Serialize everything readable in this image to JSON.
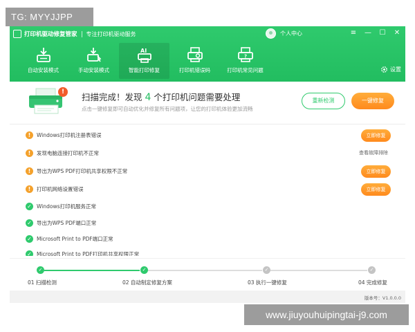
{
  "watermarks": {
    "top": "TG: MYYJJPP",
    "bottom": "www.jiuyouhuipingtai-j9.com"
  },
  "app": {
    "title": "打印机驱动修复管家",
    "subtitle": "专注打印机驱动服务",
    "user_label": "个人中心",
    "window_controls": [
      "≡",
      "—",
      "☐",
      "✕"
    ]
  },
  "nav": {
    "items": [
      {
        "label": "自动安装模式",
        "icon": "auto-install-icon",
        "active": false
      },
      {
        "label": "手动安装模式",
        "icon": "manual-install-icon",
        "active": false
      },
      {
        "label": "智能打印修复",
        "icon": "ai-repair-icon",
        "active": true
      },
      {
        "label": "打印机错误码",
        "icon": "error-code-icon",
        "active": false
      },
      {
        "label": "打印机常见问题",
        "icon": "faq-icon",
        "active": false
      }
    ],
    "settings_label": "设置"
  },
  "summary": {
    "title_prefix": "扫描完成！发现 ",
    "issue_count": "4",
    "title_suffix": " 个打印机问题需要处理",
    "description": "点击一键修复即可自动优化并修复所有问题项，让您的打印机体验更加流畅",
    "alert_mark": "!",
    "recheck_label": "重新检测",
    "fix_all_label": "一键修复"
  },
  "issues": [
    {
      "status": "warn",
      "text": "Windows打印机注册表错误",
      "action_type": "button",
      "action": "立即修复"
    },
    {
      "status": "warn",
      "text": "发现电脑连接打印机不正常",
      "action_type": "link",
      "action": "查看故障排除"
    },
    {
      "status": "warn",
      "text": "导出为WPS PDF打印机共享权限不正常",
      "action_type": "button",
      "action": "立即修复"
    },
    {
      "status": "warn",
      "text": "打印机网络设置错误",
      "action_type": "button",
      "action": "立即修复"
    },
    {
      "status": "ok",
      "text": "Windows打印机服务正常"
    },
    {
      "status": "ok",
      "text": "导出为WPS PDF端口正常"
    },
    {
      "status": "ok",
      "text": "Microsoft Print to PDF端口正常"
    },
    {
      "status": "ok",
      "text": "Microsoft Print to PDF打印机共享权限正常"
    }
  ],
  "status_marks": {
    "warn": "!",
    "ok": "✓"
  },
  "steps": [
    {
      "label": "01 扫描检测",
      "done": true
    },
    {
      "label": "02 自动制定修复方案",
      "done": true
    },
    {
      "label": "03 执行一键修复",
      "done": false
    },
    {
      "label": "04 完成修复",
      "done": false
    }
  ],
  "footer": {
    "version": "版本号：V1.0.0.0"
  },
  "colors": {
    "brand_green": "#22bd60",
    "accent_orange": "#ff8a1d",
    "warning": "#f4a12c",
    "alert_red": "#f25c2b"
  }
}
